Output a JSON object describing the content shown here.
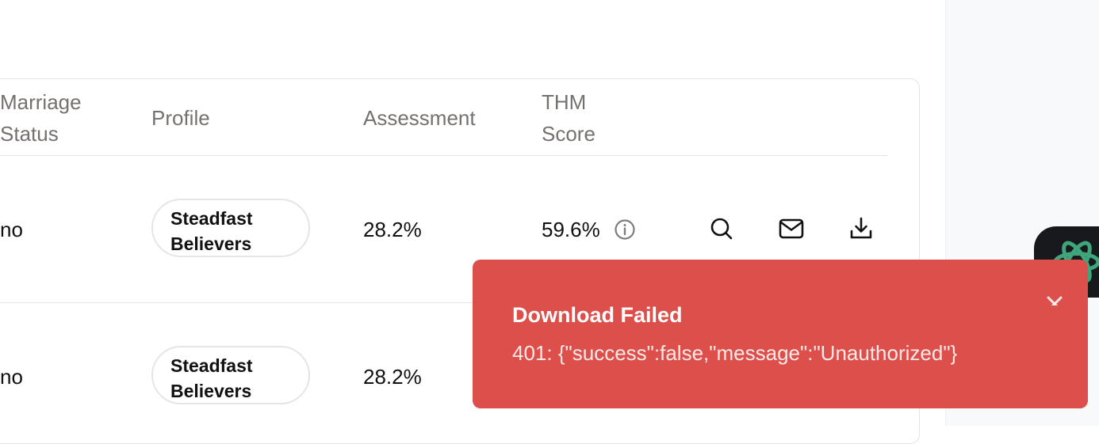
{
  "table": {
    "headers": {
      "marriage_status": [
        "Marriage",
        "Status"
      ],
      "profile": "Profile",
      "assessment": "Assessment",
      "thm_score": [
        "THM",
        "Score"
      ]
    },
    "rows": [
      {
        "marriage_status": "no",
        "profile": [
          "Steadfast",
          "Believers"
        ],
        "assessment": "28.2%",
        "thm_score": "59.6%"
      },
      {
        "marriage_status": "no",
        "profile": [
          "Steadfast",
          "Believers"
        ],
        "assessment": "28.2%"
      }
    ],
    "actions": {
      "view_icon": "search-icon",
      "email_icon": "mail-icon",
      "download_icon": "download-icon",
      "info_icon": "info-icon"
    }
  },
  "toast": {
    "title": "Download Failed",
    "message": "401: {\"success\":false,\"message\":\"Unauthorized\"}",
    "color": "#dd4f4b",
    "close_icon": "close-icon"
  },
  "assistant_fab": {
    "icon": "ai-assistant-icon",
    "color": "#17191c",
    "accent": "#3fa57a"
  }
}
